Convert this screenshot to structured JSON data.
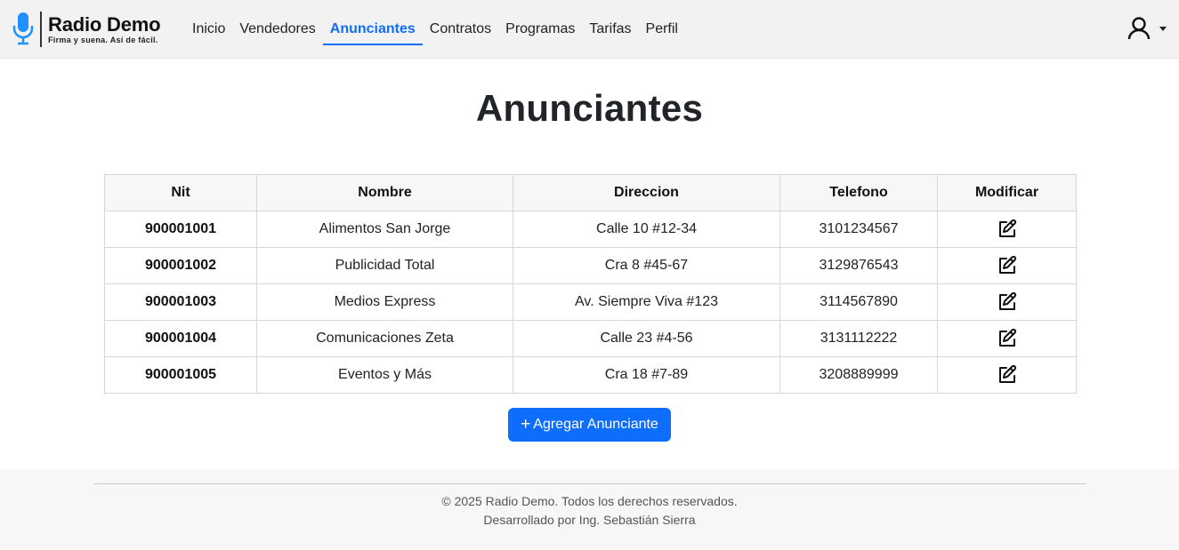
{
  "brand": {
    "title": "Radio Demo",
    "subtitle": "Firma y suena. Así de fácil.",
    "accent": "#1e90ff"
  },
  "nav": {
    "items": [
      {
        "label": "Inicio"
      },
      {
        "label": "Vendedores"
      },
      {
        "label": "Anunciantes",
        "active": true
      },
      {
        "label": "Contratos"
      },
      {
        "label": "Programas"
      },
      {
        "label": "Tarifas"
      },
      {
        "label": "Perfil"
      }
    ],
    "active_color": "#0d6efd"
  },
  "user_menu": {
    "icon": "user-icon"
  },
  "page": {
    "title": "Anunciantes"
  },
  "table": {
    "headers": [
      "Nit",
      "Nombre",
      "Direccion",
      "Telefono",
      "Modificar"
    ],
    "rows": [
      {
        "nit": "900001001",
        "nombre": "Alimentos San Jorge",
        "direccion": "Calle 10 #12-34",
        "telefono": "3101234567"
      },
      {
        "nit": "900001002",
        "nombre": "Publicidad Total",
        "direccion": "Cra 8 #45-67",
        "telefono": "3129876543"
      },
      {
        "nit": "900001003",
        "nombre": "Medios Express",
        "direccion": "Av. Siempre Viva #123",
        "telefono": "3114567890"
      },
      {
        "nit": "900001004",
        "nombre": "Comunicaciones Zeta",
        "direccion": "Calle 23 #4-56",
        "telefono": "3131112222"
      },
      {
        "nit": "900001005",
        "nombre": "Eventos y Más",
        "direccion": "Cra 18 #7-89",
        "telefono": "3208889999"
      }
    ],
    "edit_icon": "edit-icon"
  },
  "actions": {
    "add_label": "Agregar Anunciante",
    "add_icon": "plus-icon",
    "button_color": "#0d6efd"
  },
  "footer": {
    "copyright": "© 2025 Radio Demo. Todos los derechos reservados.",
    "credit": "Desarrollado por Ing. Sebastián Sierra"
  }
}
